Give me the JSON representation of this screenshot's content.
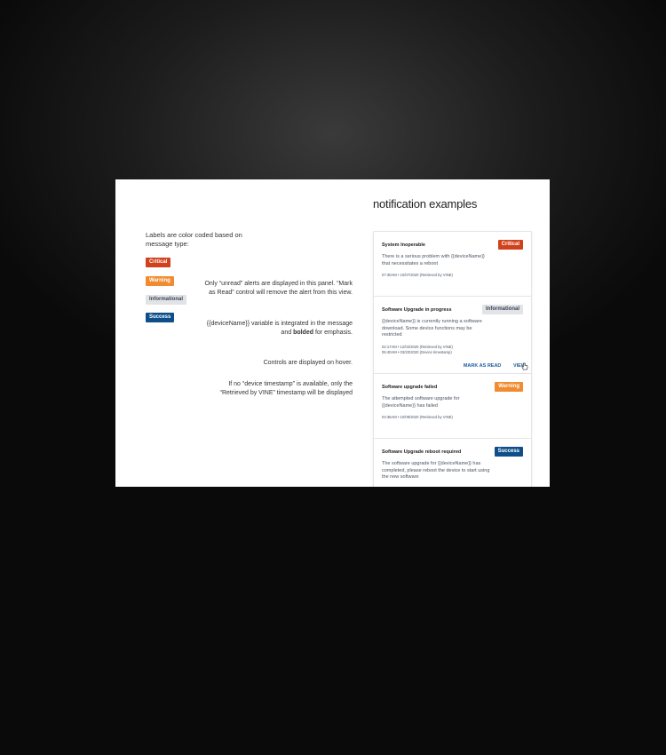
{
  "heading": "notification examples",
  "legend": {
    "intro": "Labels are color coded based on message type:",
    "labels": [
      "Critical",
      "Warning",
      "Informational",
      "Success"
    ]
  },
  "notes": [
    "Only “unread” alerts are displayed in this panel. “Mark as Read” control will remove the alert from this view.",
    "{{deviceName}} variable is integrated in the message and",
    "bolded",
    "for emphasis.",
    "Controls are displayed on hover.",
    "If no “device timestamp” is available, only the “Retrieved by VINE” timestamp will be displayed"
  ],
  "cards": [
    {
      "title": "System Inoperable",
      "badge": "Critical",
      "message": "There is a serious problem with {{deviceName}} that necessitates a reboot",
      "meta": [
        "07:30AM  •  10/07/2020  (Retrieved by VINE)"
      ]
    },
    {
      "title": "Software Upgrade in progress",
      "badge": "Informational",
      "message": "{{deviceName}} is currently running a software download. Some device functions may be restricted",
      "meta": [
        "02:17AM  •  12/02/2020  (Retrieved by VINE)",
        "05:40AM  •  03/20/2020  (Device timestamp)"
      ],
      "actions": [
        "MARK AS READ",
        "VIEW"
      ]
    },
    {
      "title": "Software upgrade failed",
      "badge": "Warning",
      "message": "The attempted software upgrade for {{deviceName}} has failed",
      "meta": [
        "04:36AM  •  10/08/2020  (Retrieved by VINE)"
      ]
    },
    {
      "title": "Software Upgrade reboot required",
      "badge": "Success",
      "message": "The software upgrade for {{deviceName}} has completed, please reboot the device to start using the new software",
      "meta": []
    }
  ],
  "colors": {
    "critical": "#d1411c",
    "warning": "#f28b30",
    "informational": "#e1e3e6",
    "success": "#0e4f8a",
    "action": "#1d5c9c"
  },
  "icons": [
    "hand-pointer-icon"
  ]
}
